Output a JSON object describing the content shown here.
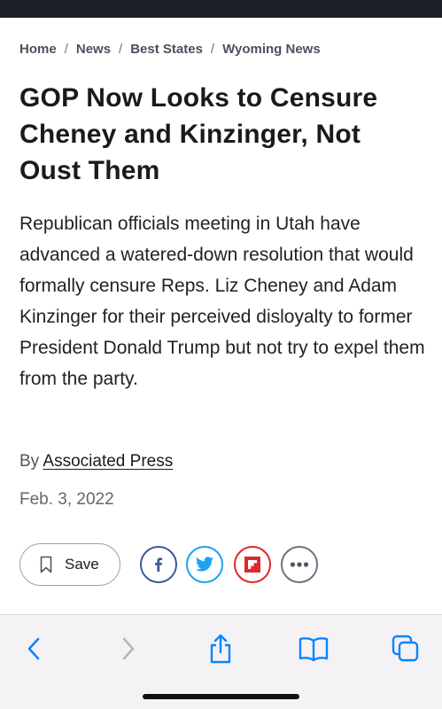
{
  "breadcrumb": {
    "items": [
      "Home",
      "News",
      "Best States",
      "Wyoming News"
    ],
    "separator": "/"
  },
  "article": {
    "headline": "GOP Now Looks to Censure Cheney and Kinzinger, Not Oust Them",
    "summary": "Republican officials meeting in Utah have advanced a watered-down resolution that would formally censure Reps. Liz Cheney and Adam Kinzinger for their perceived disloyalty to former President Donald Trump but not try to expel them from the party.",
    "byline_prefix": "By",
    "author": "Associated Press",
    "date": "Feb. 3, 2022"
  },
  "actions": {
    "save_label": "Save",
    "save_icon": "bookmark-icon",
    "share_icons": [
      "facebook-icon",
      "twitter-icon",
      "flipboard-icon",
      "more-icon"
    ]
  },
  "browser_toolbar": {
    "icons": [
      "back-chevron-icon",
      "forward-chevron-icon",
      "share-icon",
      "bookmarks-icon",
      "tabs-icon"
    ],
    "accent_color": "#0a84ff",
    "disabled_color": "#b6b6bb"
  },
  "colors": {
    "status_bar": "#1c1f2a",
    "facebook": "#3b5998",
    "twitter": "#1da1f2",
    "flipboard": "#e12828"
  }
}
